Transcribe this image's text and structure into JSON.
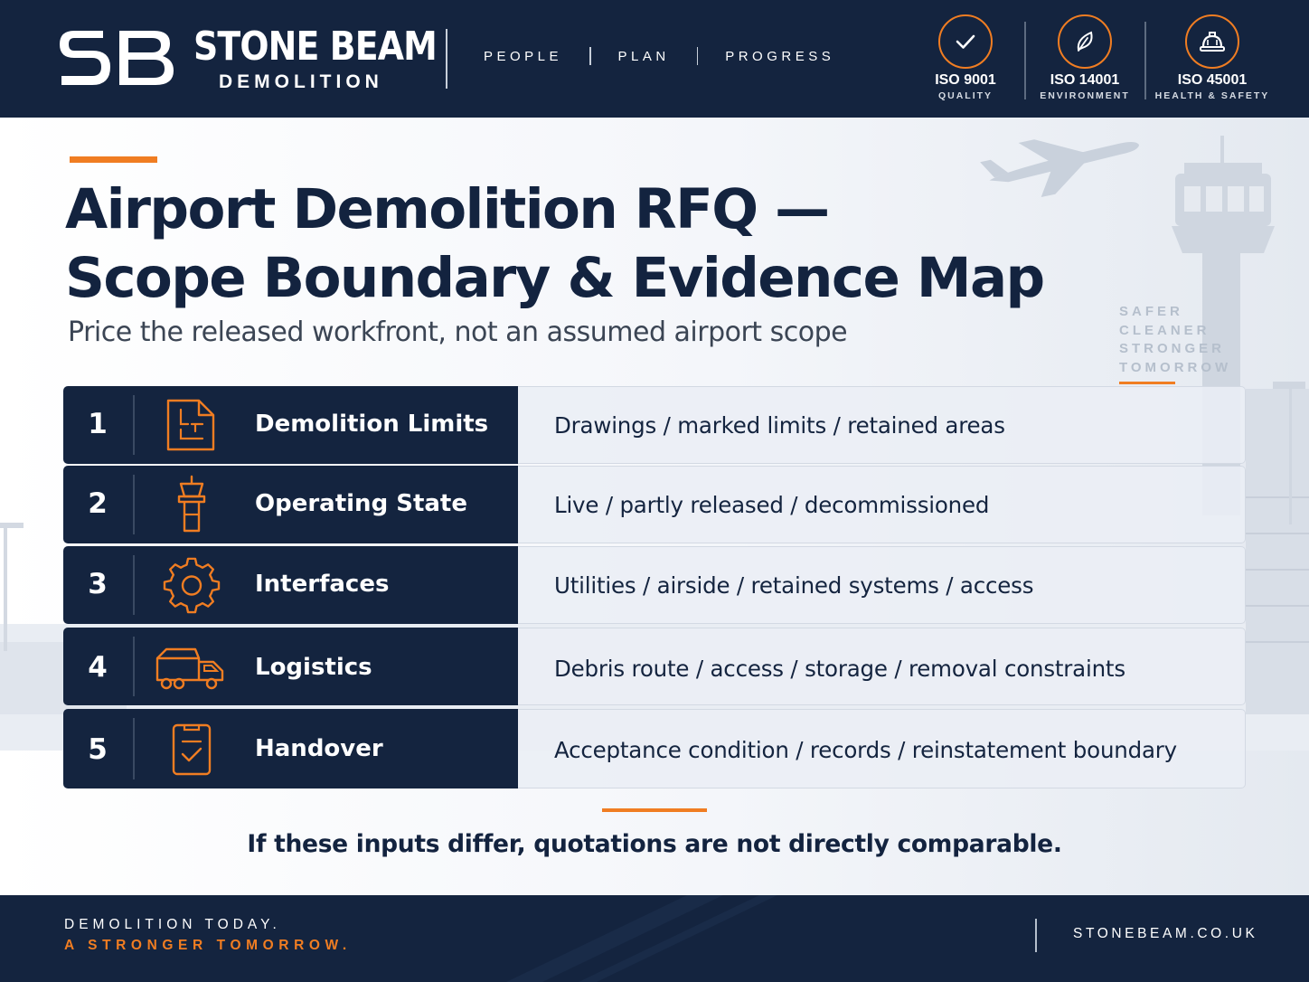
{
  "header": {
    "logo_text": "SB",
    "brand_name": "STONE BEAM",
    "brand_sub": "DEMOLITION",
    "tagline": [
      "PEOPLE",
      "PLAN",
      "PROGRESS"
    ],
    "certifications": [
      {
        "code": "ISO 9001",
        "label": "QUALITY",
        "icon": "checkmark-icon"
      },
      {
        "code": "ISO 14001",
        "label": "ENVIRONMENT",
        "icon": "leaf-icon"
      },
      {
        "code": "ISO 45001",
        "label": "HEALTH & SAFETY",
        "icon": "hard-hat-icon"
      }
    ]
  },
  "hero": {
    "title_line1": "Airport Demolition RFQ —",
    "title_line2": "Scope Boundary & Evidence Map",
    "subtitle": "Price the released workfront, not an assumed airport scope",
    "motto": [
      "SAFER",
      "CLEANER",
      "STRONGER",
      "TOMORROW"
    ]
  },
  "rows": [
    {
      "number": "1",
      "label": "Demolition Limits",
      "icon": "floor-plan-icon",
      "description": "Drawings / marked limits / retained areas"
    },
    {
      "number": "2",
      "label": "Operating State",
      "icon": "control-tower-icon",
      "description": "Live / partly released / decommissioned"
    },
    {
      "number": "3",
      "label": "Interfaces",
      "icon": "gear-icon",
      "description": "Utilities / airside / retained systems / access"
    },
    {
      "number": "4",
      "label": "Logistics",
      "icon": "truck-icon",
      "description": "Debris route / access / storage / removal constraints"
    },
    {
      "number": "5",
      "label": "Handover",
      "icon": "checklist-icon",
      "description": "Acceptance condition / records / reinstatement boundary"
    }
  ],
  "conclusion": "If these inputs differ, quotations are not directly comparable.",
  "footer": {
    "line1": "DEMOLITION TODAY.",
    "line2": "A STRONGER TOMORROW.",
    "url": "STONEBEAM.CO.UK"
  },
  "colors": {
    "navy": "#14243f",
    "accent": "#f07d22",
    "row_light": "#eaeef5",
    "text_dark": "#13233f"
  }
}
